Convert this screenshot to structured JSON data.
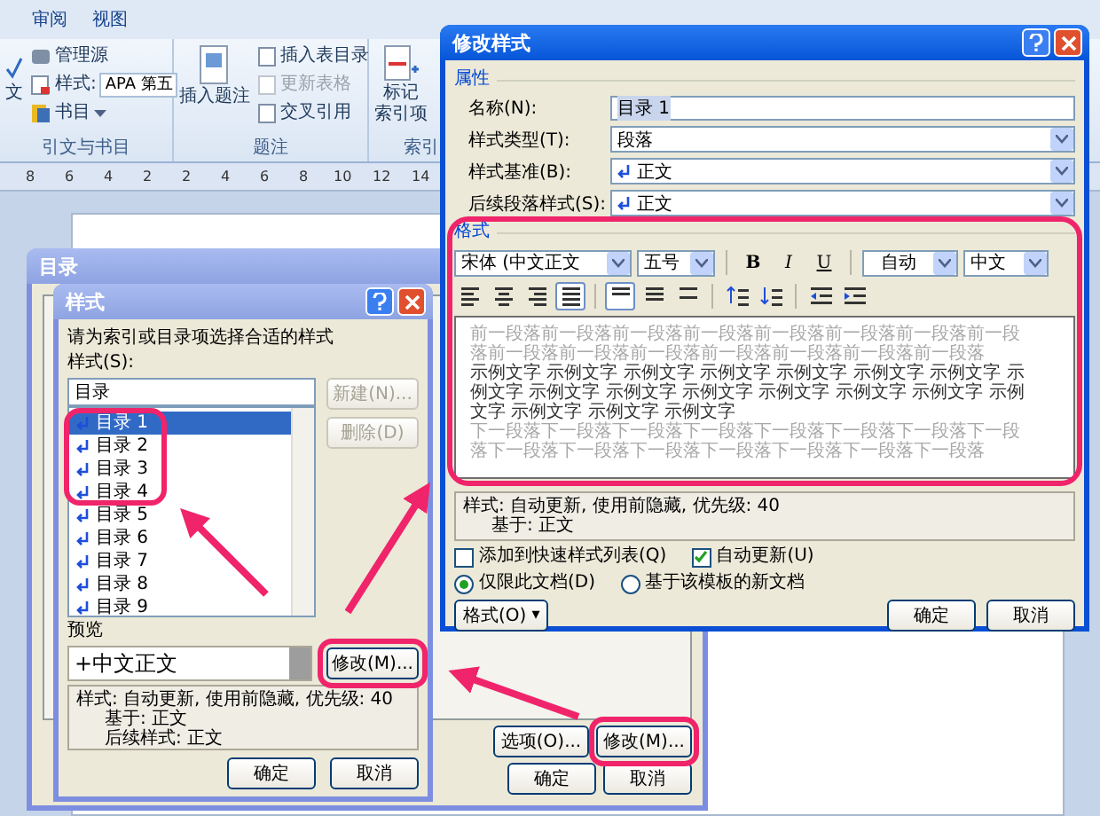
{
  "ribbon": {
    "tabs": [
      {
        "label": "审阅"
      },
      {
        "label": "视图"
      }
    ],
    "citations": {
      "label": "引文与书目",
      "edge_button": "文",
      "manage_sources": "管理源",
      "style_label": "样式:",
      "style_value": "APA 第五",
      "bibliography": "书目"
    },
    "captions": {
      "label": "题注",
      "insert_caption": "插入题注",
      "items": [
        {
          "label": "插入表目录",
          "disabled": false
        },
        {
          "label": "更新表格",
          "disabled": true
        },
        {
          "label": "交叉引用",
          "disabled": false
        }
      ]
    },
    "index": {
      "label": "索引",
      "mark_entry": [
        "标记",
        "索引项"
      ]
    }
  },
  "ruler": {
    "labels": [
      "8",
      "6",
      "4",
      "2",
      "2",
      "4",
      "6",
      "8",
      "10",
      "12",
      "14"
    ]
  },
  "toc_dialog": {
    "title": "目录",
    "buttons": [
      "选项(O)...",
      "修改(M)..."
    ],
    "footer": [
      "确定",
      "取消"
    ]
  },
  "style_dialog": {
    "title": "样式",
    "instruction": "请为索引或目录项选择合适的样式",
    "styles_label": "样式(S):",
    "style_field": "目录",
    "styles": [
      {
        "label": "目录 1",
        "selected": true
      },
      {
        "label": "目录 2",
        "selected": false
      },
      {
        "label": "目录 3",
        "selected": false
      },
      {
        "label": "目录 4",
        "selected": false
      },
      {
        "label": "目录 5",
        "selected": false
      },
      {
        "label": "目录 6",
        "selected": false
      },
      {
        "label": "目录 7",
        "selected": false
      },
      {
        "label": "目录 8",
        "selected": false
      },
      {
        "label": "目录 9",
        "selected": false
      }
    ],
    "side_buttons": [
      {
        "label": "新建(N)...",
        "disabled": true
      },
      {
        "label": "删除(D)",
        "disabled": true
      }
    ],
    "preview_label": "预览",
    "preview_text": "+中文正文",
    "modify_button": "修改(M)...",
    "description": [
      "样式: 自动更新, 使用前隐藏, 优先级: 40",
      "基于: 正文",
      "后续样式: 正文"
    ],
    "footer": [
      "确定",
      "取消"
    ]
  },
  "modify_dialog": {
    "title": "修改样式",
    "properties_heading": "属性",
    "fields": [
      {
        "label": "名称(N):",
        "value": "目录 1",
        "kind": "text",
        "text_selected": true
      },
      {
        "label": "样式类型(T):",
        "value": "段落",
        "kind": "select"
      },
      {
        "label": "样式基准(B):",
        "value": "正文",
        "kind": "style_select"
      },
      {
        "label": "后续段落样式(S):",
        "value": "正文",
        "kind": "style_select"
      }
    ],
    "format_heading": "格式",
    "font": "宋体 (中文正文",
    "size": "五号",
    "text_styles": [
      "B",
      "I",
      "U"
    ],
    "font_color_label": "自动",
    "language": "中文",
    "paragraph_tools": [
      [
        {
          "kind": "left",
          "selected": false
        },
        {
          "kind": "center",
          "selected": false
        },
        {
          "kind": "right",
          "selected": false
        },
        {
          "kind": "justify",
          "selected": true
        }
      ],
      [
        {
          "kind": "single",
          "selected": true
        },
        {
          "kind": "one_half",
          "selected": false
        },
        {
          "kind": "double",
          "selected": false
        }
      ],
      [
        {
          "kind": "space_up",
          "selected": false
        },
        {
          "kind": "space_down",
          "selected": false
        }
      ],
      [
        {
          "kind": "outdent",
          "selected": false
        },
        {
          "kind": "indent",
          "selected": false
        }
      ]
    ],
    "preview": {
      "before": "前一段落前一段落前一段落前一段落前一段落前一段落前一段落前一段落前一段落前一段落前一段落前一段落前一段落前一段落前一段落",
      "sample": "示例文字 示例文字 示例文字 示例文字 示例文字 示例文字 示例文字 示例文字 示例文字 示例文字 示例文字 示例文字 示例文字 示例文字 示例文字 示例文字 示例文字 示例文字",
      "after": "下一段落下一段落下一段落下一段落下一段落下一段落下一段落下一段落下一段落下一段落下一段落下一段落下一段落下一段落下一段落"
    },
    "description": [
      "样式: 自动更新, 使用前隐藏, 优先级: 40",
      "基于: 正文"
    ],
    "checkboxes": [
      {
        "label": "添加到快速样式列表(Q)",
        "checked": false
      },
      {
        "label": "自动更新(U)",
        "checked": true
      }
    ],
    "radios": [
      {
        "label": "仅限此文档(D)",
        "selected": true
      },
      {
        "label": "基于该模板的新文档",
        "selected": false
      }
    ],
    "format_button": "格式(O)",
    "format_button_caret": "▾",
    "footer": [
      "确定",
      "取消"
    ]
  }
}
